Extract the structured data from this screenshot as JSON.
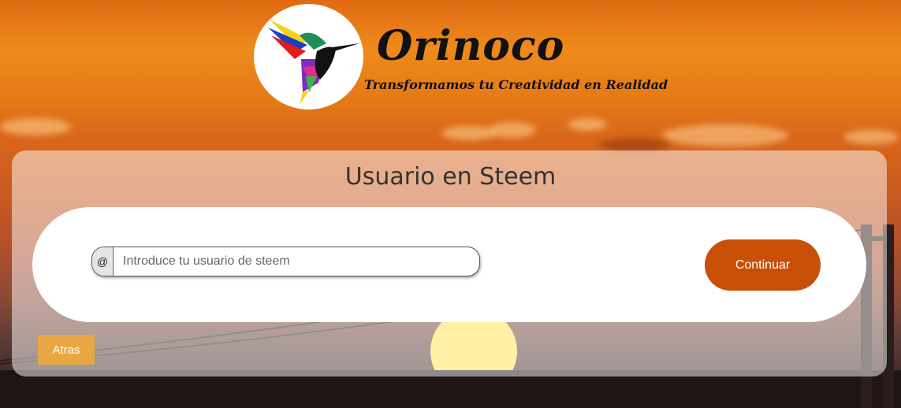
{
  "header": {
    "brand_name": "Orinoco",
    "tagline": "Transformamos tu Creatividad en Realidad",
    "logo_icon": "hummingbird-icon"
  },
  "main": {
    "title": "Usuario en Steem",
    "username_prefix": "@",
    "username_placeholder": "Introduce tu usuario de steem",
    "username_value": "",
    "continue_label": "Continuar",
    "back_label": "Atras"
  },
  "colors": {
    "continue_button": "#c74f07",
    "back_button": "#e9a744",
    "sky_top": "#e06a12"
  }
}
